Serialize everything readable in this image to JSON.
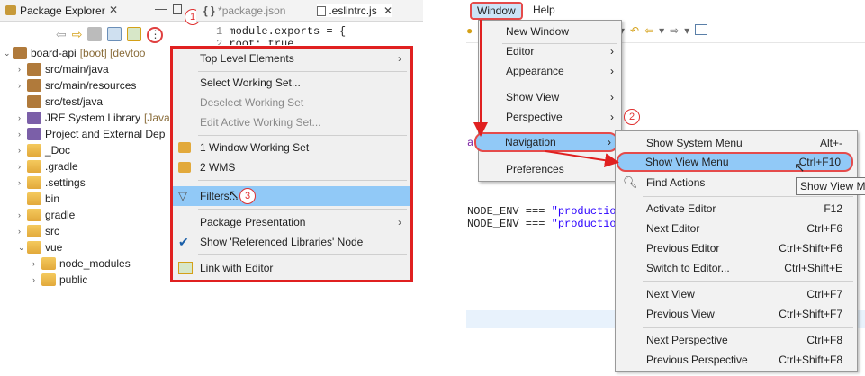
{
  "left": {
    "package_explorer_tab": "Package Explorer",
    "editor_tabs": [
      "*package.json",
      ".eslintrc.js"
    ],
    "code_line1_num": "1",
    "code_line1": "module.exports = {",
    "code_line2_num": "2",
    "code_line2": "  root: true,",
    "tree": [
      {
        "label": "board-api",
        "suffix": "[boot] [devtoo",
        "twisty": "v",
        "indent": 0,
        "icon": "project"
      },
      {
        "label": "src/main/java",
        "twisty": ">",
        "indent": 1,
        "icon": "package-folder"
      },
      {
        "label": "src/main/resources",
        "twisty": ">",
        "indent": 1,
        "icon": "package-folder"
      },
      {
        "label": "src/test/java",
        "twisty": "",
        "indent": 1,
        "icon": "package-folder"
      },
      {
        "label": "JRE System Library",
        "suffix": "[Java",
        "twisty": ">",
        "indent": 1,
        "icon": "library"
      },
      {
        "label": "Project and External Dep",
        "twisty": ">",
        "indent": 1,
        "icon": "library"
      },
      {
        "label": "_Doc",
        "twisty": ">",
        "indent": 1,
        "icon": "folder"
      },
      {
        "label": ".gradle",
        "twisty": ">",
        "indent": 1,
        "icon": "folder"
      },
      {
        "label": ".settings",
        "twisty": ">",
        "indent": 1,
        "icon": "folder"
      },
      {
        "label": "bin",
        "twisty": "",
        "indent": 1,
        "icon": "folder"
      },
      {
        "label": "gradle",
        "twisty": ">",
        "indent": 1,
        "icon": "folder"
      },
      {
        "label": "src",
        "twisty": ">",
        "indent": 1,
        "icon": "folder"
      },
      {
        "label": "vue",
        "twisty": "v",
        "indent": 1,
        "icon": "folder"
      },
      {
        "label": "node_modules",
        "twisty": ">",
        "indent": 2,
        "icon": "folder"
      },
      {
        "label": "public",
        "twisty": ">",
        "indent": 2,
        "icon": "folder"
      }
    ],
    "context_menu": {
      "items": [
        {
          "label": "Top Level Elements",
          "submenu": true
        },
        {
          "label": "Select Working Set..."
        },
        {
          "label": "Deselect Working Set",
          "disabled": true
        },
        {
          "label": "Edit Active Working Set...",
          "disabled": true
        },
        {
          "label": "1 Window Working Set"
        },
        {
          "label": "2 WMS"
        },
        {
          "label": "Filters..."
        },
        {
          "label": "Package Presentation",
          "submenu": true
        },
        {
          "label": "Show 'Referenced Libraries' Node",
          "checked": true
        },
        {
          "label": "Link with Editor"
        }
      ]
    },
    "badges": [
      "1",
      "3"
    ]
  },
  "right": {
    "menubar": {
      "window": "Window",
      "help": "Help"
    },
    "window_menu": [
      {
        "label": "New Window"
      },
      {
        "label": "Editor",
        "submenu": true
      },
      {
        "label": "Appearance",
        "submenu": true
      },
      {
        "label": "Show View",
        "submenu": true
      },
      {
        "label": "Perspective",
        "submenu": true
      },
      {
        "label": "Navigation",
        "submenu": true
      },
      {
        "label": "Preferences"
      }
    ],
    "navigation_submenu": [
      {
        "label": "Show System Menu",
        "shortcut": "Alt+-"
      },
      {
        "label": "Show View Menu",
        "shortcut": "Ctrl+F10"
      },
      {
        "label": "Find Actions",
        "shortcut": ""
      },
      {
        "label": "Activate Editor",
        "shortcut": "F12"
      },
      {
        "label": "Next Editor",
        "shortcut": "Ctrl+F6"
      },
      {
        "label": "Previous Editor",
        "shortcut": "Ctrl+Shift+F6"
      },
      {
        "label": "Switch to Editor...",
        "shortcut": "Ctrl+Shift+E"
      },
      {
        "label": "Next View",
        "shortcut": "Ctrl+F7"
      },
      {
        "label": "Previous View",
        "shortcut": "Ctrl+Shift+F7"
      },
      {
        "label": "Next Perspective",
        "shortcut": "Ctrl+F8"
      },
      {
        "label": "Previous Perspective",
        "shortcut": "Ctrl+Shift+F8"
      }
    ],
    "tooltip": "Show View M",
    "badge": "2",
    "code_line1_a": "NODE_ENV === ",
    "code_line1_b": "\"production\"",
    "code_line2_a": "NODE_ENV === ",
    "code_line2_b": "\"production",
    "code_char": "a"
  },
  "colors": {
    "highlight": "#91c9f7",
    "annotation_red": "#e02020",
    "menu_bg": "#f2f2f2"
  }
}
